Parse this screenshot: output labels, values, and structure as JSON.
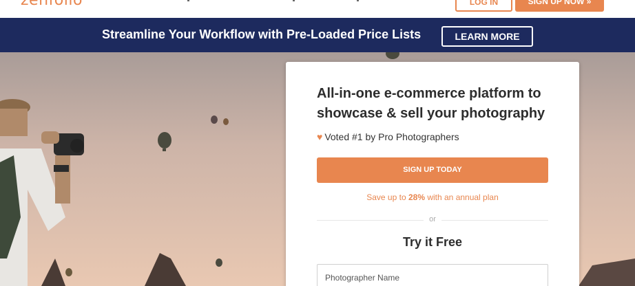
{
  "nav": {
    "logo_text": "zenfolio",
    "login_label": "LOG IN",
    "signup_label": "SIGN UP NOW »"
  },
  "banner": {
    "text": "Streamline Your Workflow with Pre-Loaded Price Lists",
    "button_label": "LEARN MORE"
  },
  "card": {
    "title": "All-in-one e-commerce platform to showcase & sell your photography",
    "voted_icon": "heart-icon",
    "voted_text": "Voted #1 by Pro Photographers",
    "cta_label": "SIGN UP TODAY",
    "save_prefix": "Save up to ",
    "save_percent": "28%",
    "save_suffix": " with an annual plan",
    "or_text": "or",
    "try_title": "Try it Free",
    "name_placeholder": "Photographer Name"
  },
  "colors": {
    "accent": "#e8864f",
    "banner_bg": "#1d2a5e"
  }
}
